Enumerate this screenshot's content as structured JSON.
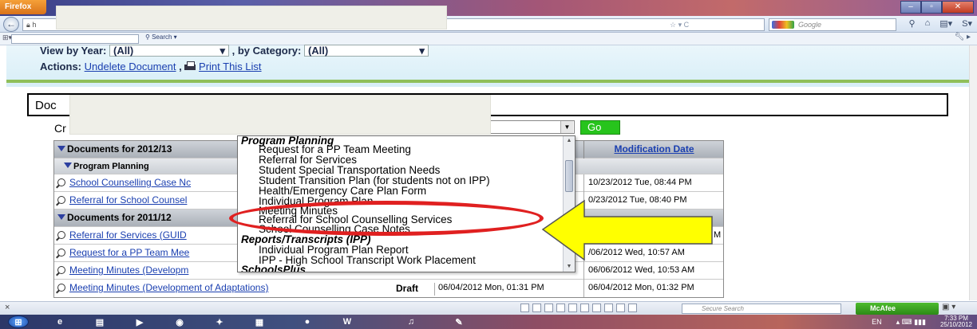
{
  "browser": {
    "app_button": "Firefox",
    "url_prefix": "h",
    "search_engine_placeholder": "Google",
    "toolbar_search_label": "Search",
    "window_controls": {
      "minimize": "–",
      "maximize": "▫",
      "close": "✕"
    }
  },
  "filters": {
    "view_by_year_label": "View by Year:",
    "year_value": "(All)",
    "separator": ",",
    "by_category_label": "by Category:",
    "category_value": "(All)"
  },
  "actions": {
    "label": "Actions:",
    "undelete": "Undelete Document",
    "separator": ",",
    "print": "Print This List"
  },
  "doc_box_label": "Doc",
  "create_label": "Cr",
  "go_label": "Go",
  "table": {
    "modification_header": "Modification Date",
    "groups": [
      {
        "title": "Documents for 2012/13",
        "subgroup": "Program Planning",
        "rows": [
          {
            "title": "School Counselling Case Nc",
            "mod": "10/23/2012 Tue, 08:44 PM"
          },
          {
            "title": "Referral for School Counsel",
            "mod": "0/23/2012 Tue, 08:40 PM"
          }
        ]
      },
      {
        "title": "Documents for 2011/12",
        "rows": [
          {
            "title": "Referral for Services (GUID",
            "mod": "M"
          },
          {
            "title": "Request for a PP Team Mee",
            "mod": "/06/2012 Wed, 10:57 AM"
          },
          {
            "title": "Meeting Minutes (Developm",
            "mod": "06/06/2012 Wed, 10:53 AM"
          },
          {
            "title": "Meeting Minutes (Development of Adaptations)",
            "status": "Draft",
            "created": "06/04/2012 Mon, 01:31 PM",
            "mod": "06/04/2012 Mon, 01:32 PM"
          }
        ]
      }
    ]
  },
  "dropdown": {
    "items": [
      {
        "type": "group",
        "label": "Program Planning"
      },
      {
        "type": "option",
        "label": "Request for a PP Team Meeting"
      },
      {
        "type": "option",
        "label": "Referral for Services"
      },
      {
        "type": "option",
        "label": "Student Special Transportation Needs"
      },
      {
        "type": "option",
        "label": "Student Transition Plan (for students not on IPP)"
      },
      {
        "type": "option",
        "label": "Health/Emergency Care Plan Form"
      },
      {
        "type": "option",
        "label": "Individual Program Plan"
      },
      {
        "type": "option",
        "label": "Meeting Minutes"
      },
      {
        "type": "option",
        "label": "Referral for School Counselling Services"
      },
      {
        "type": "option",
        "label": "School Counselling Case Notes"
      },
      {
        "type": "group",
        "label": "Reports/Transcripts (IPP)"
      },
      {
        "type": "option",
        "label": "Individual Program Plan Report"
      },
      {
        "type": "option",
        "label": "IPP - High School Transcript Work Placement"
      },
      {
        "type": "group",
        "label": "SchoolsPlus"
      }
    ]
  },
  "statusbar": {
    "close_glyph": "×",
    "secure_search_placeholder": "Secure Search",
    "mcafee_label": "McAfee"
  },
  "taskbar": {
    "lang": "EN",
    "time": "7:33 PM",
    "date": "25/10/2012"
  },
  "colors": {
    "go_button": "#27c41c",
    "highlight_ellipse": "#e02020",
    "arrow": "#ffff00",
    "link": "#1a3fb0"
  }
}
